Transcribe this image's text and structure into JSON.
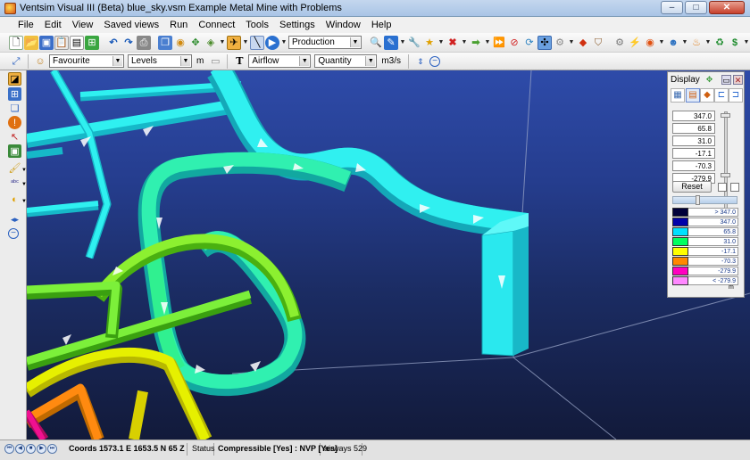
{
  "window": {
    "title": "Ventsim Visual III (Beta)   blue_sky.vsm   Example Metal Mine with Problems",
    "minimize": "–",
    "maximize": "□",
    "close": "✕"
  },
  "menu": [
    "File",
    "Edit",
    "View",
    "Saved views",
    "Run",
    "Connect",
    "Tools",
    "Settings",
    "Window",
    "Help"
  ],
  "toolbar": {
    "mode_select": "Production",
    "favourite_select": "Favourite",
    "levels_select": "Levels",
    "levels_unit": "m",
    "text_icon_label": "T",
    "airflow_select": "Airflow",
    "quantity_select": "Quantity",
    "quantity_unit": "m3/s"
  },
  "display_panel": {
    "title": "Display",
    "range_fields": [
      "347.0",
      "65.8",
      "31.0",
      "-17.1",
      "-70.3",
      "-279.9"
    ],
    "reset_label": "Reset",
    "legend": [
      {
        "color": "#00003a",
        "label": "> 347.0"
      },
      {
        "color": "#0000aa",
        "label": "347.0"
      },
      {
        "color": "#00e0ff",
        "label": "65.8"
      },
      {
        "color": "#00ff60",
        "label": "31.0"
      },
      {
        "color": "#ffff00",
        "label": "-17.1"
      },
      {
        "color": "#ff8800",
        "label": "-70.3"
      },
      {
        "color": "#ff00c0",
        "label": "-279.9"
      },
      {
        "color": "#ff88ff",
        "label": "< -279.9"
      }
    ],
    "unit": "m"
  },
  "status": {
    "coords_label": "Coords",
    "coords_value": "1573.1 E   1653.5 N   65 Z",
    "status_label": "Status",
    "status_value": "Compressible [Yes] : NVP [Yes]",
    "airways": "airways 529"
  },
  "colors": {
    "cyan": "#2ff0f0",
    "green": "#7cf03a",
    "yellow": "#e6f000",
    "orange": "#ff8a10",
    "magenta": "#f01090"
  }
}
